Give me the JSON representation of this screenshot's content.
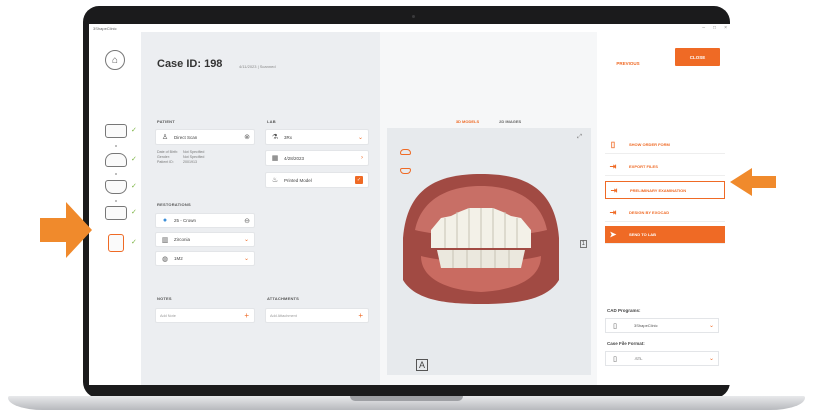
{
  "window": {
    "title": "3ShapeClinic",
    "controls": [
      "–",
      "□",
      "×"
    ]
  },
  "case": {
    "title": "Case ID: 198",
    "subtitle": "4/11/2023 | Scanned"
  },
  "patient": {
    "section": "PATIENT",
    "name": "Direct Scan",
    "details_labels": [
      "Date of Birth:",
      "Gender:",
      "Patient ID:"
    ],
    "details_values": [
      "Not Specified",
      "Not Specified",
      "2001913"
    ]
  },
  "lab": {
    "section": "LAB",
    "name": "3Rx",
    "date": "4/28/2023",
    "printed_model": "Printed Model"
  },
  "restorations": {
    "section": "RESTORATIONS",
    "items": [
      "25 - Crown",
      "Zirconia",
      "1M2"
    ]
  },
  "notes": {
    "section": "NOTES",
    "placeholder": "Add Note"
  },
  "attachments": {
    "section": "ATTACHMENTS",
    "placeholder": "Add Attachment"
  },
  "viewer": {
    "tabs": [
      "3D MODELS",
      "2D IMAGES"
    ],
    "label_a": "A"
  },
  "buttons": {
    "previous": "PREVIOUS",
    "close": "CLOSE"
  },
  "actions": [
    "SHOW ORDER FORM",
    "EXPORT FILES",
    "PRELIMINARY EXAMINATION",
    "DESIGN BY EXOCAD",
    "SEND TO LAB"
  ],
  "cad": {
    "programs_label": "CAD Programs:",
    "program": "3ShapeClinic",
    "format_label": "Case File Format:",
    "format": ".STL"
  },
  "colors": {
    "accent": "#ef6a25",
    "check": "#79b341"
  }
}
